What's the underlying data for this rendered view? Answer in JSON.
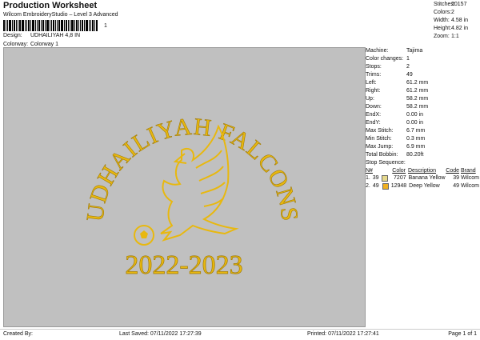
{
  "header": {
    "title": "Production Worksheet",
    "subtitle": "Wilcom EmbroideryStudio – Level 3 Advanced",
    "barcode_suffix": "1",
    "design_label": "Design:",
    "design_value": "UDHAILIYAH 4,8 IN",
    "colorway_label": "Colorway:",
    "colorway_value": "Colorway 1"
  },
  "summary": [
    {
      "label": "Stitches:",
      "value": "20157"
    },
    {
      "label": "Colors:",
      "value": "2"
    },
    {
      "label": "Width:",
      "value": "4.58 in"
    },
    {
      "label": "Height:",
      "value": "4.82 in"
    },
    {
      "label": "Zoom:",
      "value": "1:1"
    }
  ],
  "design_preview": {
    "arc_text": "UDHAILIYAH FALCONS",
    "year_text": "2022-2023",
    "thread_color": "#e8b80f",
    "background": "#c0c0c0"
  },
  "machine_info": [
    {
      "label": "Machine:",
      "value": "Tajima"
    },
    {
      "label": "Color changes:",
      "value": "1"
    },
    {
      "label": "Stops:",
      "value": "2"
    },
    {
      "label": "Trims:",
      "value": "49"
    },
    {
      "label": "Left:",
      "value": "61.2 mm"
    },
    {
      "label": "Right:",
      "value": "61.2 mm"
    },
    {
      "label": "Up:",
      "value": "58.2 mm"
    },
    {
      "label": "Down:",
      "value": "58.2 mm"
    },
    {
      "label": "EndX:",
      "value": "0.00 in"
    },
    {
      "label": "EndY:",
      "value": "0.00 in"
    },
    {
      "label": "Max Stitch:",
      "value": "6.7 mm"
    },
    {
      "label": "Min Stitch:",
      "value": "0.3 mm"
    },
    {
      "label": "Max Jump:",
      "value": "6.9 mm"
    },
    {
      "label": "Total Bobbin:",
      "value": "80.20ft"
    }
  ],
  "stop_sequence": {
    "title": "Stop Sequence:",
    "headers": [
      "N#",
      "Color",
      "Description",
      "Code",
      "Brand"
    ],
    "rows": [
      {
        "num": "1.",
        "needle": "39",
        "swatch": "#e6d98c",
        "color": "7207",
        "description": "Banana Yellow",
        "code": "39",
        "brand": "Wilcom"
      },
      {
        "num": "2.",
        "needle": "49",
        "swatch": "#f0b020",
        "color": "12948",
        "description": "Deep Yellow",
        "code": "49",
        "brand": "Wilcom"
      }
    ]
  },
  "footer": {
    "created_by": "Created By:",
    "last_saved": "Last Saved: 07/11/2022 17:27:39",
    "printed": "Printed: 07/11/2022 17:27:41",
    "page": "Page 1 of 1"
  }
}
